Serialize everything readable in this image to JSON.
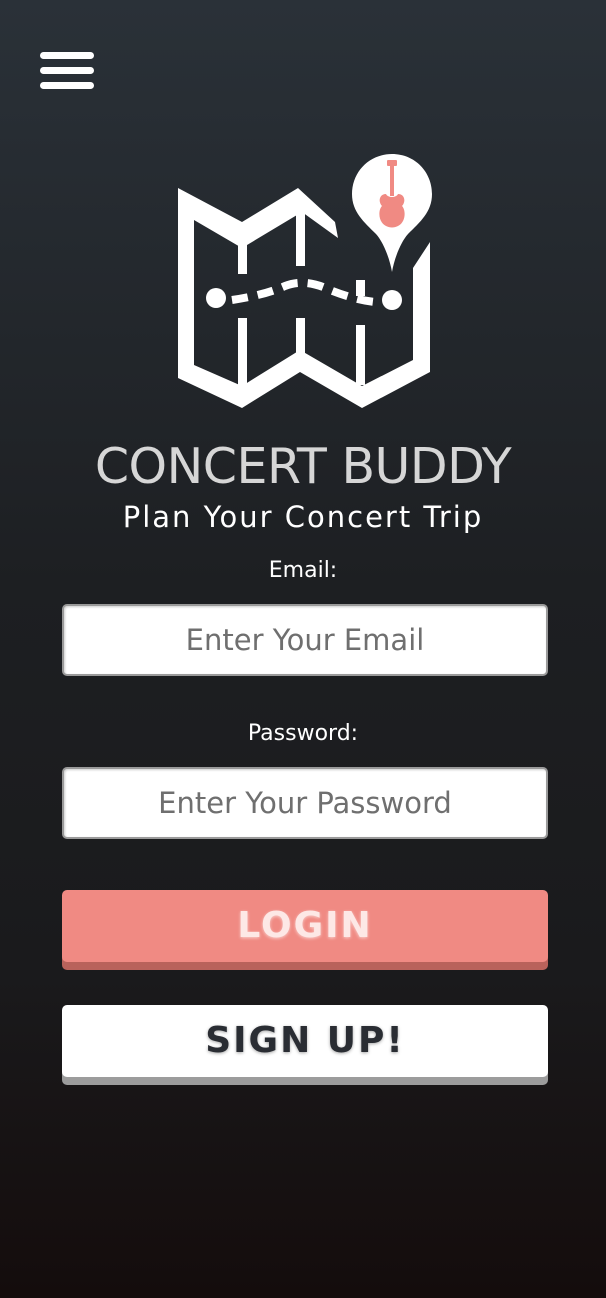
{
  "header": {
    "menu_icon": "hamburger-menu-icon"
  },
  "logo": {
    "icon": "folded-map-with-guitar-pin-icon",
    "accent_color": "#f08a83"
  },
  "app": {
    "title": "CONCERT BUDDY",
    "tagline": "Plan Your Concert Trip"
  },
  "form": {
    "email_label": "Email:",
    "email_placeholder": "Enter Your Email",
    "email_value": "",
    "password_label": "Password:",
    "password_placeholder": "Enter Your Password",
    "password_value": "",
    "login_label": "LOGIN",
    "signup_label": "SIGN UP!"
  },
  "colors": {
    "login_button": "#f08a83",
    "signup_button": "#ffffff",
    "background_top": "#2a3138",
    "background_bottom": "#140c0c"
  }
}
